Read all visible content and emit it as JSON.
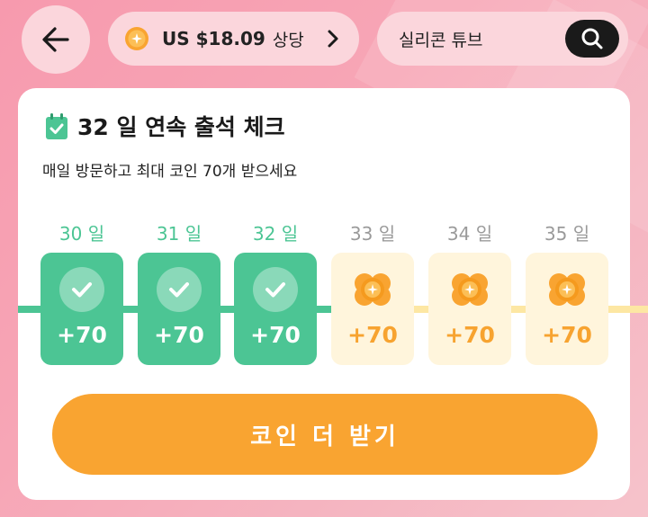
{
  "header": {
    "coin_amount": "US $18.09",
    "coin_suffix": "상당",
    "search_text": "실리콘 튜브"
  },
  "card": {
    "title": "32 일 연속 출석 체크",
    "subtitle": "매일 방문하고 최대 코인 70개 받으세요",
    "days": [
      {
        "label": "30 일",
        "reward": "+70",
        "done": true
      },
      {
        "label": "31 일",
        "reward": "+70",
        "done": true
      },
      {
        "label": "32 일",
        "reward": "+70",
        "done": true
      },
      {
        "label": "33 일",
        "reward": "+70",
        "done": false
      },
      {
        "label": "34 일",
        "reward": "+70",
        "done": false
      },
      {
        "label": "35 일",
        "reward": "+70",
        "done": false
      }
    ],
    "cta_label": "코인 더 받기"
  },
  "colors": {
    "green": "#4cc594",
    "orange": "#f9a431",
    "pink_bg": "#f79aae"
  },
  "icons": {
    "back": "back-arrow-icon",
    "coin": "coin-icon",
    "chevron": "chevron-right-icon",
    "search": "search-icon",
    "calendar": "calendar-check-icon",
    "check": "check-icon",
    "coin_stack": "coin-stack-icon"
  }
}
